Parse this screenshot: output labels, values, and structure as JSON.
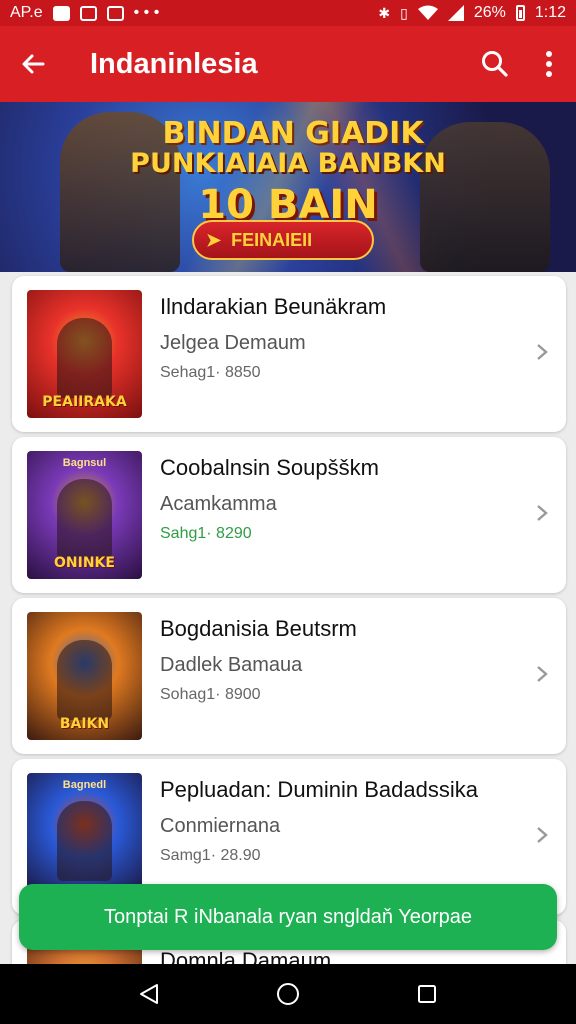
{
  "status_bar": {
    "left_text": "AP.e",
    "dots": "• • •",
    "battery": "26%",
    "time": "1:12",
    "icons": [
      "notification-icon",
      "shield-icon",
      "image-icon",
      "bluetooth-icon",
      "vibrate-icon",
      "wifi-icon",
      "signal-icon",
      "battery-icon"
    ]
  },
  "app_bar": {
    "title": "Indaninlesia",
    "icons": [
      "back-arrow-icon",
      "search-icon",
      "more-vert-icon"
    ]
  },
  "banner": {
    "line1": "BINDAN GIADIK",
    "line2": "PUNKIAIAIA BANBKN",
    "line3": "10 BAIN",
    "button_label": "FEINAIEII"
  },
  "items": [
    {
      "title": "Ilndarakian Beunäkram",
      "subtitle": "Jelgea Demaum",
      "meta": "Sehag1· 8850",
      "meta_color": "gray",
      "thumb_top": "",
      "thumb_caption": "PEAIIRAKA",
      "thumb_colors": [
        "#e8322a",
        "#7a1010",
        "#f0a030"
      ]
    },
    {
      "title": "Coobalnsin Soupšškm",
      "subtitle": "Acamkamma",
      "meta": "Sahg1· 8290",
      "meta_color": "green",
      "thumb_top": "Bagnsul",
      "thumb_caption": "ONINKE",
      "thumb_colors": [
        "#7a3ab8",
        "#2a1040",
        "#d8a030"
      ]
    },
    {
      "title": "Bogdanisia Beutsrm",
      "subtitle": "Dadlek Bamaua",
      "meta": "Sohag1· 8900",
      "meta_color": "gray",
      "thumb_top": "",
      "thumb_caption": "BAIKN",
      "thumb_colors": [
        "#e07a20",
        "#3a1a10",
        "#2a6ad0"
      ]
    },
    {
      "title": "Pepluadan: Duminin Badadssika",
      "subtitle": "Conmiernana",
      "meta": "Samg1· 28.90",
      "meta_color": "gray",
      "thumb_top": "Bagnedl",
      "thumb_caption": "",
      "thumb_colors": [
        "#2a5ad8",
        "#1a1030",
        "#e0502a"
      ]
    },
    {
      "title": "Domnla Damaum",
      "subtitle": "",
      "meta": "",
      "meta_color": "gray",
      "thumb_top": "",
      "thumb_caption": "",
      "thumb_colors": [
        "#d07030",
        "#401a10",
        "#f0b030"
      ]
    }
  ],
  "toast": {
    "text": "Tonptai R iNbanala ryan sngldaň Yeorpae"
  },
  "nav_bar": {
    "icons": [
      "back-triangle-icon",
      "home-circle-icon",
      "recents-square-icon"
    ]
  }
}
